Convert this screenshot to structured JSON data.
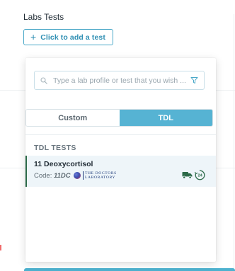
{
  "section": {
    "title": "Labs Tests"
  },
  "add_button": {
    "plus": "+",
    "label": "Click to add a test"
  },
  "search": {
    "placeholder": "Type a lab profile or test that you wish ...",
    "value": ""
  },
  "tabs": [
    {
      "label": "Custom",
      "selected": false
    },
    {
      "label": "TDL",
      "selected": true
    }
  ],
  "results": {
    "group_title": "TDL TESTS",
    "items": [
      {
        "name": "11 Deoxycortisol",
        "code_label": "Code:",
        "code": "11DC",
        "lab_name_line1": "THE DOCTORS",
        "lab_name_line2": "LABORATORY",
        "turnaround_badge": "24"
      }
    ]
  },
  "colors": {
    "accent": "#56b3d3",
    "accent_text": "#2f8fb3",
    "row_highlight": "#eef5f9",
    "row_border": "#2c6a49",
    "icon_green": "#2c6a49"
  },
  "icons": [
    "plus-icon",
    "search-icon",
    "filter-icon",
    "lab-logo",
    "delivery-truck-icon",
    "clock-24-icon"
  ]
}
